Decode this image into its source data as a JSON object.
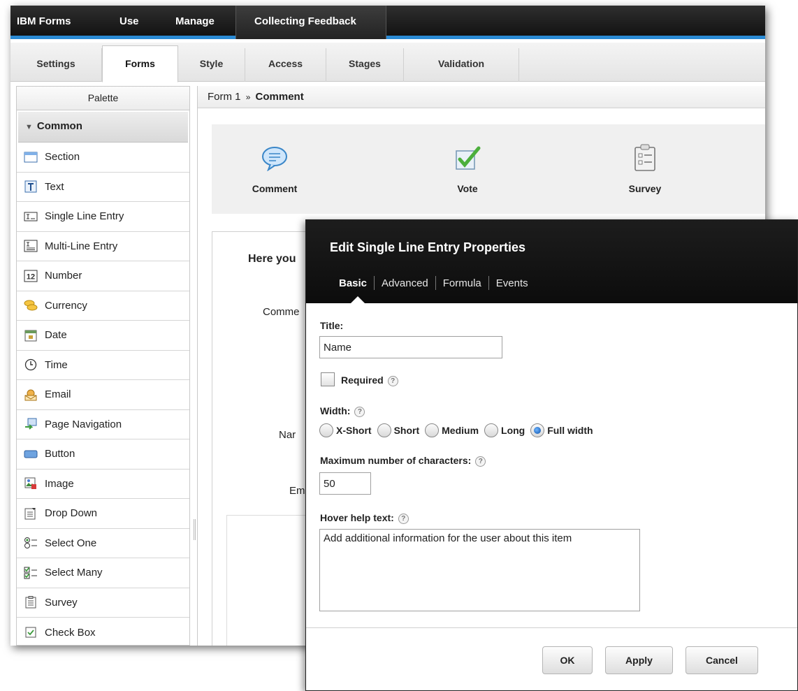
{
  "topbar": {
    "brand": "IBM Forms",
    "menu_use": "Use",
    "menu_manage": "Manage",
    "active_app": "Collecting Feedback"
  },
  "tabs": [
    "Settings",
    "Forms",
    "Style",
    "Access",
    "Stages",
    "Validation"
  ],
  "selected_tab": "Forms",
  "palette": {
    "title": "Palette",
    "group": "Common",
    "items": [
      {
        "label": "Section",
        "icon": "section-icon"
      },
      {
        "label": "Text",
        "icon": "text-icon"
      },
      {
        "label": "Single Line Entry",
        "icon": "single-line-entry-icon"
      },
      {
        "label": "Multi-Line Entry",
        "icon": "multi-line-entry-icon"
      },
      {
        "label": "Number",
        "icon": "number-icon"
      },
      {
        "label": "Currency",
        "icon": "currency-icon"
      },
      {
        "label": "Date",
        "icon": "date-icon"
      },
      {
        "label": "Time",
        "icon": "time-icon"
      },
      {
        "label": "Email",
        "icon": "email-icon"
      },
      {
        "label": "Page Navigation",
        "icon": "page-navigation-icon"
      },
      {
        "label": "Button",
        "icon": "button-icon"
      },
      {
        "label": "Image",
        "icon": "image-icon"
      },
      {
        "label": "Drop Down",
        "icon": "drop-down-icon"
      },
      {
        "label": "Select One",
        "icon": "select-one-icon"
      },
      {
        "label": "Select Many",
        "icon": "select-many-icon"
      },
      {
        "label": "Survey",
        "icon": "survey-icon"
      },
      {
        "label": "Check Box",
        "icon": "check-box-icon"
      }
    ]
  },
  "breadcrumb": {
    "form": "Form 1",
    "separator": "»",
    "current": "Comment"
  },
  "templates": [
    {
      "label": "Comment",
      "icon": "comment-bubble-icon"
    },
    {
      "label": "Vote",
      "icon": "vote-check-icon"
    },
    {
      "label": "Survey",
      "icon": "survey-clipboard-icon"
    }
  ],
  "canvas": {
    "heading_partial": "Here you",
    "label_comment_partial": "Comme",
    "label_name_partial": "Nar",
    "label_email_partial": "Em"
  },
  "dialog": {
    "title": "Edit Single Line Entry Properties",
    "tabs": [
      "Basic",
      "Advanced",
      "Formula",
      "Events"
    ],
    "current_tab": "Basic",
    "title_label": "Title:",
    "title_value": "Name",
    "required_label": "Required",
    "required_checked": false,
    "width_label": "Width:",
    "width_options": [
      "X-Short",
      "Short",
      "Medium",
      "Long",
      "Full width"
    ],
    "width_selected": "Full width",
    "max_chars_label": "Maximum number of characters:",
    "max_chars_value": "50",
    "hover_help_label": "Hover help text:",
    "hover_help_value": "Add additional information for the user about this item",
    "help_glyph": "?",
    "buttons": {
      "ok": "OK",
      "apply": "Apply",
      "cancel": "Cancel"
    }
  },
  "colors": {
    "accent_blue": "#2a8ad4",
    "topbar_dark": "#1a1a1a",
    "dialog_header": "#111111"
  }
}
